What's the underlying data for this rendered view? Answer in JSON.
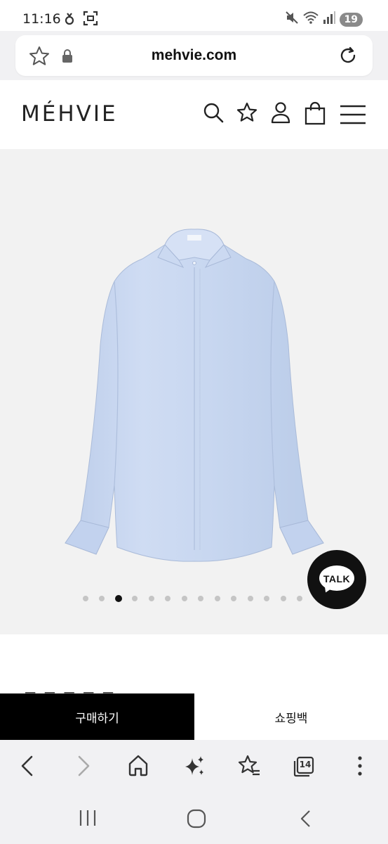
{
  "status_bar": {
    "time": "11:16",
    "battery": "19",
    "left_icons": [
      "notification-icon",
      "screenshot-icon"
    ],
    "right_icons": [
      "mute-icon",
      "wifi-icon",
      "signal-icon"
    ]
  },
  "url_bar": {
    "url": "mehvie.com",
    "icons": [
      "star-icon",
      "lock-icon",
      "reload-icon"
    ]
  },
  "site_header": {
    "logo": "MÉHVIE",
    "icons": [
      "search-icon",
      "wishlist-star-icon",
      "account-icon",
      "shopping-bag-icon",
      "menu-icon"
    ]
  },
  "product": {
    "image": "light-blue-shirt",
    "gallery_count": 15,
    "gallery_active_index": 2
  },
  "chat": {
    "label": "TALK"
  },
  "actions": {
    "buy_label": "구매하기",
    "cart_label": "쇼핑백"
  },
  "browser_toolbar": {
    "tab_count": "14",
    "icons": [
      "back-icon",
      "forward-icon",
      "home-icon",
      "ai-sparkle-icon",
      "bookmarks-icon",
      "tabs-icon",
      "more-icon"
    ]
  },
  "android_nav": {
    "icons": [
      "recents-icon",
      "home-button-icon",
      "back-nav-icon"
    ]
  },
  "colors": {
    "accent": "#000000",
    "product_bg": "#f2f2f2",
    "shirt": "#c9d9f1",
    "toolbar_bg": "#f1f1f3"
  }
}
